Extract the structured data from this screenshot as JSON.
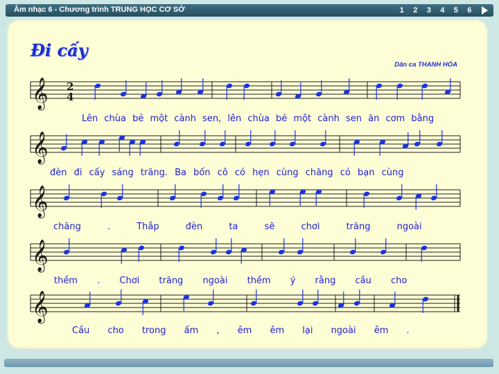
{
  "header": {
    "title": "Âm nhạc 6 - Chương trình TRUNG HỌC CƠ SỞ",
    "pages": [
      "1",
      "2",
      "3",
      "4",
      "5",
      "6"
    ]
  },
  "song": {
    "title": "Đi cấy",
    "composer": "Dân ca THANH HÓA",
    "time_signature": [
      "2",
      "4"
    ],
    "lyrics": [
      "Lên chùa bẻ một cành sen, lên chùa bẻ một cành sen ăn cơm bằng",
      "đèn đi cấy sáng trăng. Ba bốn cô có hẹn cùng chăng có bạn cùng",
      "chăng . Thắp đèn ta sẽ chơi trăng ngoài",
      "thềm . Chơi trăng ngoài thềm ý rằng cầu cho",
      "Cầu cho trong ấm , êm êm lại ngoài êm ."
    ]
  },
  "colors": {
    "note_color": "#1a33e0",
    "staff_color": "#1a1a1a",
    "panel_bg": "#fdfdd6",
    "page_bg": "#cfe7e4",
    "topbar": "#2f5d6e"
  }
}
